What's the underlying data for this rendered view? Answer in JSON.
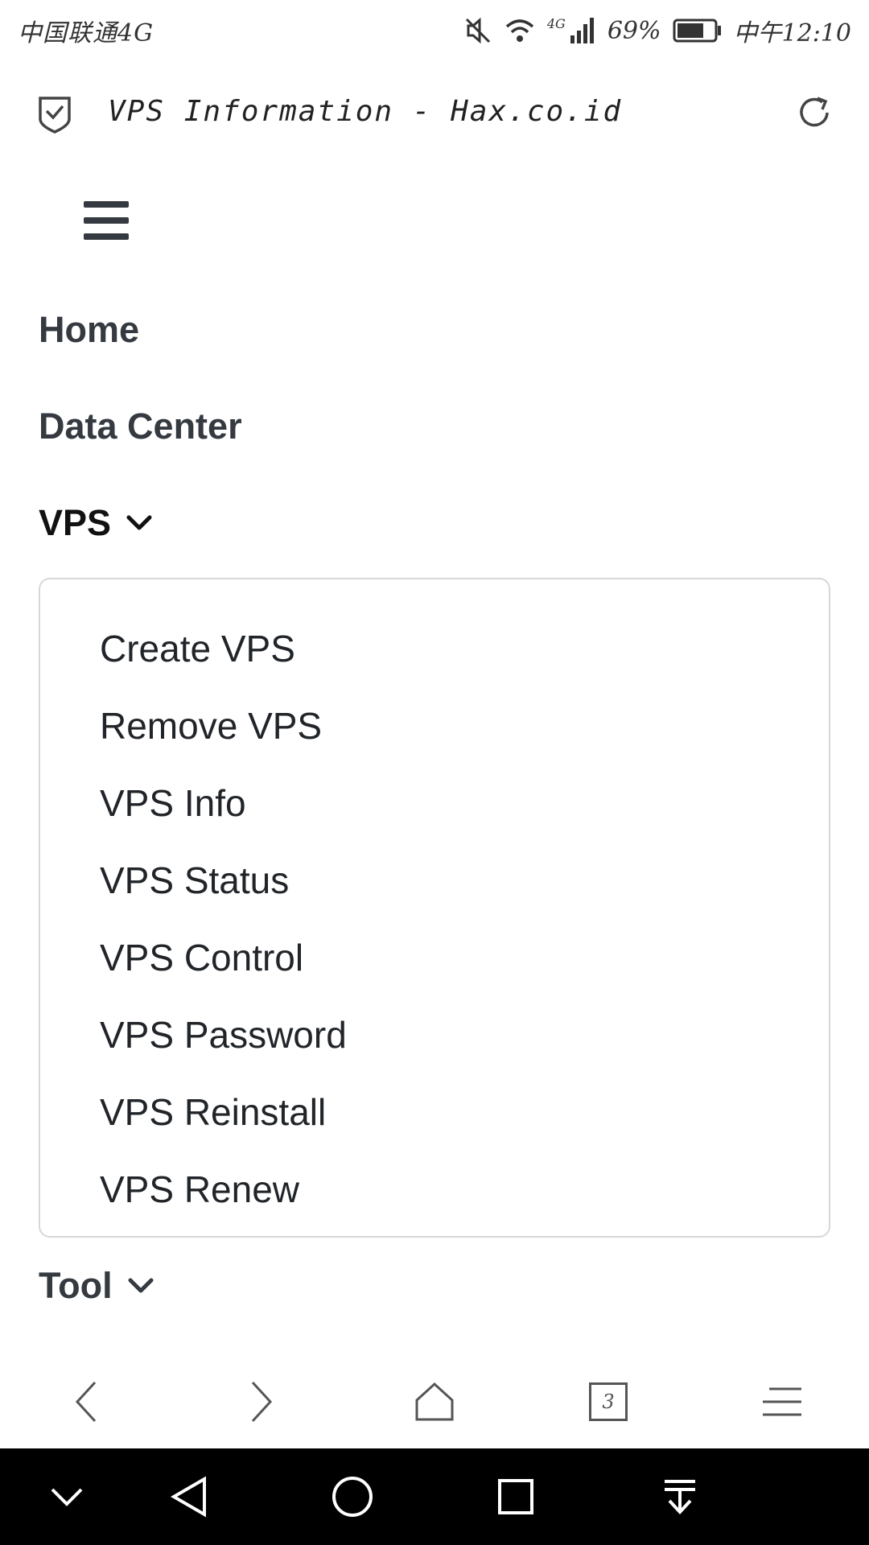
{
  "status_bar": {
    "carrier": "中国联通4G",
    "network": "4G",
    "battery": "69%",
    "time": "中午12:10"
  },
  "browser": {
    "page_title": "VPS Information - Hax.co.id",
    "tab_count": "3"
  },
  "nav": {
    "items": [
      {
        "label": "Home"
      },
      {
        "label": "Data Center"
      },
      {
        "label": "VPS"
      },
      {
        "label": "Tool"
      }
    ],
    "vps_menu": [
      "Create VPS",
      "Remove VPS",
      "VPS Info",
      "VPS Status",
      "VPS Control",
      "VPS Password",
      "VPS Reinstall",
      "VPS Renew"
    ]
  },
  "colors": {
    "nav_text": "#343a40",
    "active_text": "#111111",
    "menu_border": "#d7d7d7",
    "system_nav_bg": "#000000"
  }
}
